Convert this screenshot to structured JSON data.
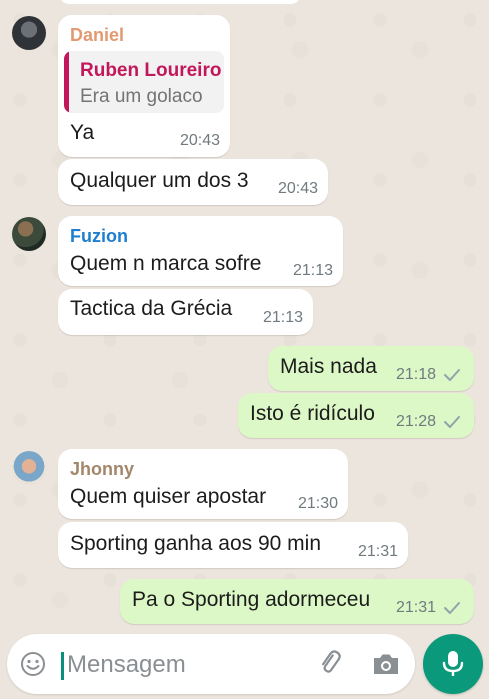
{
  "theme": {
    "incoming_bg": "#ffffff",
    "outgoing_bg": "#dcf8c6",
    "wallpaper": "#ece5dd",
    "accent": "#0a9a7b",
    "tick_color": "#8fa3ab"
  },
  "messages": [
    {
      "sender": "Daniel",
      "sender_color": "#e39a73",
      "reply": {
        "name": "Ruben Loureiro",
        "text": "Era um golaco"
      },
      "text": "Ya",
      "time": "20:43"
    },
    {
      "text": "Qualquer um dos 3",
      "time": "20:43"
    },
    {
      "sender": "Fuzion",
      "sender_color": "#1f7ecf",
      "text": "Quem n marca sofre",
      "time": "21:13"
    },
    {
      "text": "Tactica da Grécia",
      "time": "21:13"
    },
    {
      "text": "Mais nada",
      "time": "21:18",
      "status": "sent"
    },
    {
      "text": "Isto é ridículo",
      "time": "21:28",
      "status": "sent"
    },
    {
      "sender": "Jhonny",
      "sender_color": "#a3876b",
      "text": "Quem quiser apostar",
      "time": "21:30"
    },
    {
      "text": "Sporting ganha aos 90 min",
      "time": "21:31"
    },
    {
      "text": "Pa o Sporting adormeceu",
      "time": "21:31",
      "status": "sent"
    }
  ],
  "composer": {
    "placeholder": "Mensagem",
    "icons": [
      "emoji-icon",
      "paperclip-icon",
      "camera-icon",
      "microphone-icon"
    ]
  }
}
